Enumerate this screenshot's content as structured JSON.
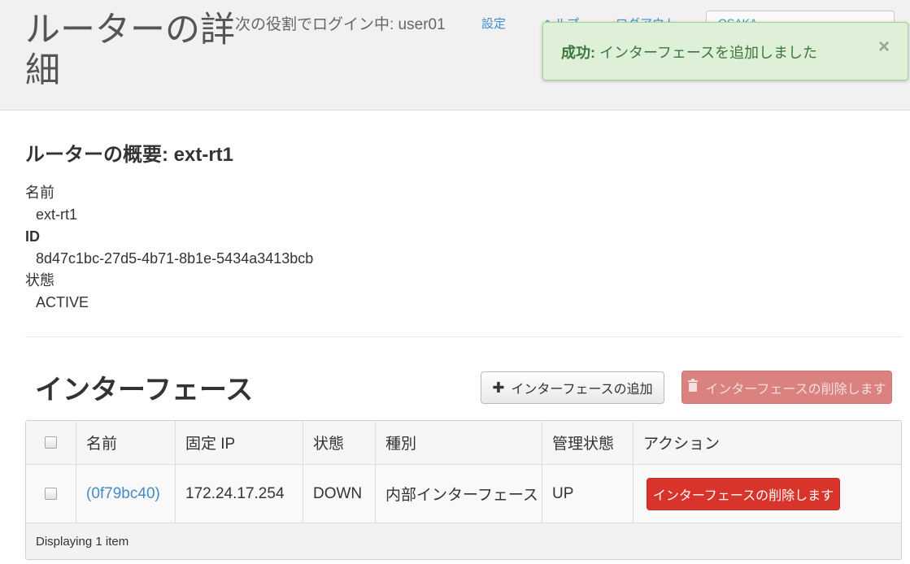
{
  "header": {
    "title": "ルーターの詳細",
    "login_info": "次の役割でログイン中: user01",
    "nav": [
      "設定",
      "ヘルプ",
      "ログアウト"
    ],
    "region": "OSAKA"
  },
  "alert": {
    "label": "成功:",
    "message": " インターフェースを追加しました",
    "close": "×"
  },
  "overview": {
    "title": "ルーターの概要: ext-rt1",
    "fields": [
      {
        "label": "名前",
        "value": "ext-rt1"
      },
      {
        "label": "ID",
        "value": "8d47c1bc-27d5-4b71-8b1e-5434a3413bcb"
      },
      {
        "label": "状態",
        "value": "ACTIVE"
      }
    ]
  },
  "interfaces": {
    "title": "インターフェース",
    "add_button": "インターフェースの追加",
    "delete_button": "インターフェースの削除します",
    "columns": [
      "名前",
      "固定 IP",
      "状態",
      "種別",
      "管理状態",
      "アクション"
    ],
    "rows": [
      {
        "name": "(0f79bc40)",
        "fixed_ip": "172.24.17.254",
        "status": "DOWN",
        "type": "内部インターフェース",
        "admin_state": "UP",
        "action": "インターフェースの削除します"
      }
    ],
    "footer": "Displaying 1 item"
  },
  "colors": {
    "accent": "#428bca",
    "success_bg": "#dff0d8",
    "danger": "#d9342b"
  }
}
